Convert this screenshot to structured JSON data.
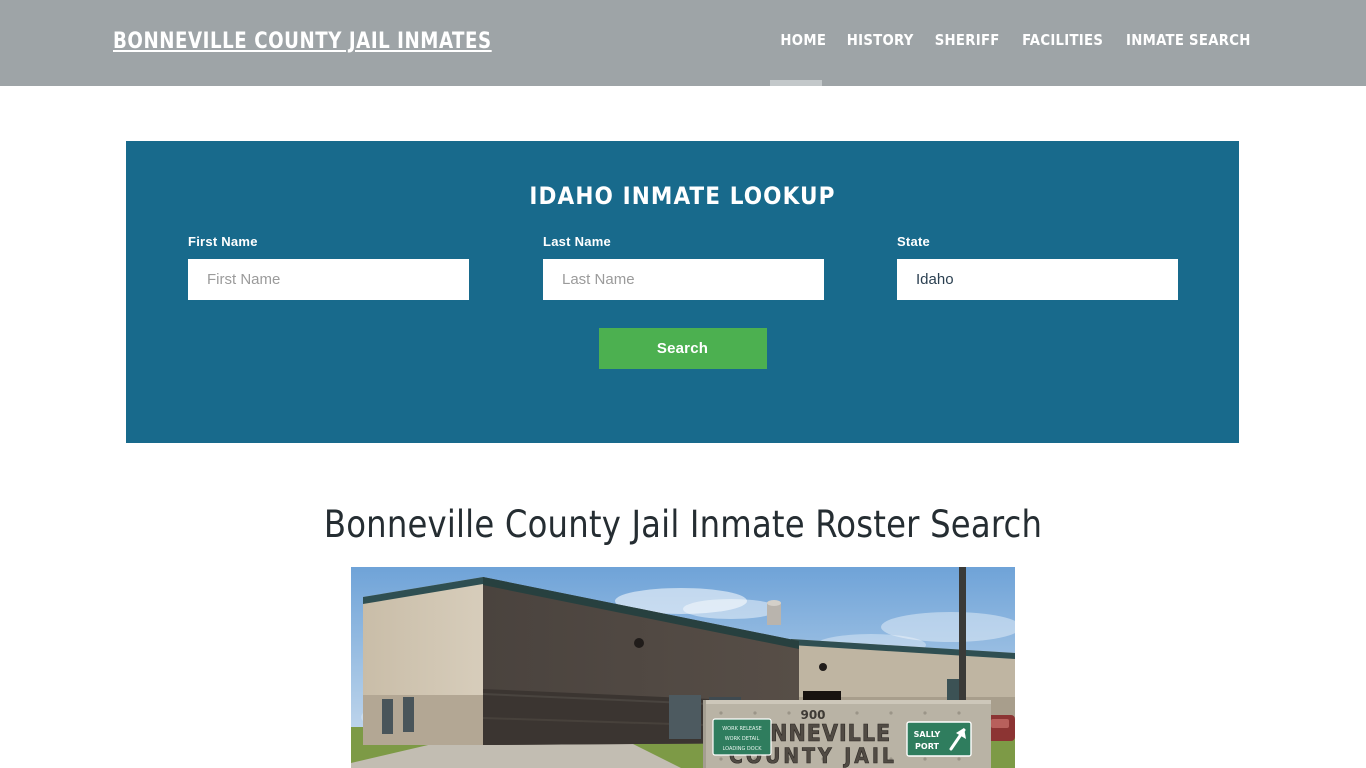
{
  "header": {
    "brand": "BONNEVILLE COUNTY JAIL INMATES",
    "brand_color": "#ffffff",
    "background_color": "#9ea4a7",
    "nav": [
      {
        "label": "HOME",
        "active": true
      },
      {
        "label": "HISTORY",
        "active": false
      },
      {
        "label": "SHERIFF",
        "active": false
      },
      {
        "label": "FACILITIES",
        "active": false
      },
      {
        "label": "INMATE SEARCH",
        "active": false
      }
    ],
    "active_indicator_color": "#c3c8ca"
  },
  "lookup": {
    "title": "IDAHO INMATE LOOKUP",
    "panel_color": "#186a8c",
    "fields": {
      "first_name": {
        "label": "First Name",
        "placeholder": "First Name",
        "value": ""
      },
      "last_name": {
        "label": "Last Name",
        "placeholder": "Last Name",
        "value": ""
      },
      "state": {
        "label": "State",
        "value": "Idaho",
        "options": [
          "Idaho"
        ]
      }
    },
    "search_button": {
      "label": "Search",
      "color": "#4cb050"
    }
  },
  "main": {
    "heading": "Bonneville County Jail Inmate Roster Search",
    "photo": {
      "alt": "Bonneville County Jail building exterior with entrance sign",
      "sign": {
        "address_number": "900",
        "line1": "BONNEVILLE",
        "line2": "COUNTY  JAIL",
        "sally_port_label_line1": "SALLY",
        "sally_port_label_line2": "PORT",
        "side_sign_line1": "WORK RELEASE",
        "side_sign_line2": "WORK DETAIL",
        "side_sign_line3": "LOADING DOCK"
      },
      "colors": {
        "sky": "#8cb4dc",
        "brick_light": "#cdc2ae",
        "brick_dark": "#4b4440",
        "roof_trim": "#2f4f52",
        "grass": "#74913f",
        "sidewalk": "#c4bfb4",
        "sign_concrete": "#b9b3a5",
        "sign_green": "#2f7d5e"
      }
    }
  }
}
